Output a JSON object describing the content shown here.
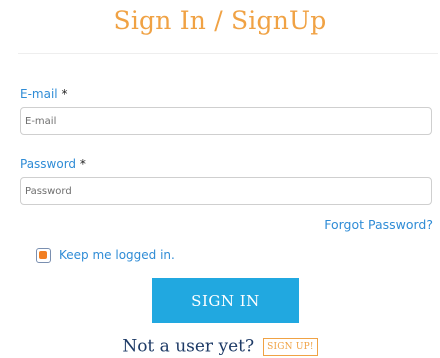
{
  "header": {
    "title": "Sign In / SignUp"
  },
  "form": {
    "email": {
      "label": "E-mail",
      "required_mark": "*",
      "placeholder": "E-mail",
      "value": ""
    },
    "password": {
      "label": "Password",
      "required_mark": "*",
      "placeholder": "Password",
      "value": ""
    },
    "forgot_password": "Forgot Password?",
    "keep_logged_in": {
      "label": "Keep me logged in.",
      "checked": true
    },
    "signin_button": "SIGN IN"
  },
  "footer": {
    "prompt": "Not a user yet?",
    "signup_button": "SIGN UP!"
  },
  "colors": {
    "title": "#f0a244",
    "link": "#2f8cd6",
    "primary_button": "#21a8e0",
    "checkbox_fill": "#f27f22",
    "prompt": "#1d3a66"
  }
}
